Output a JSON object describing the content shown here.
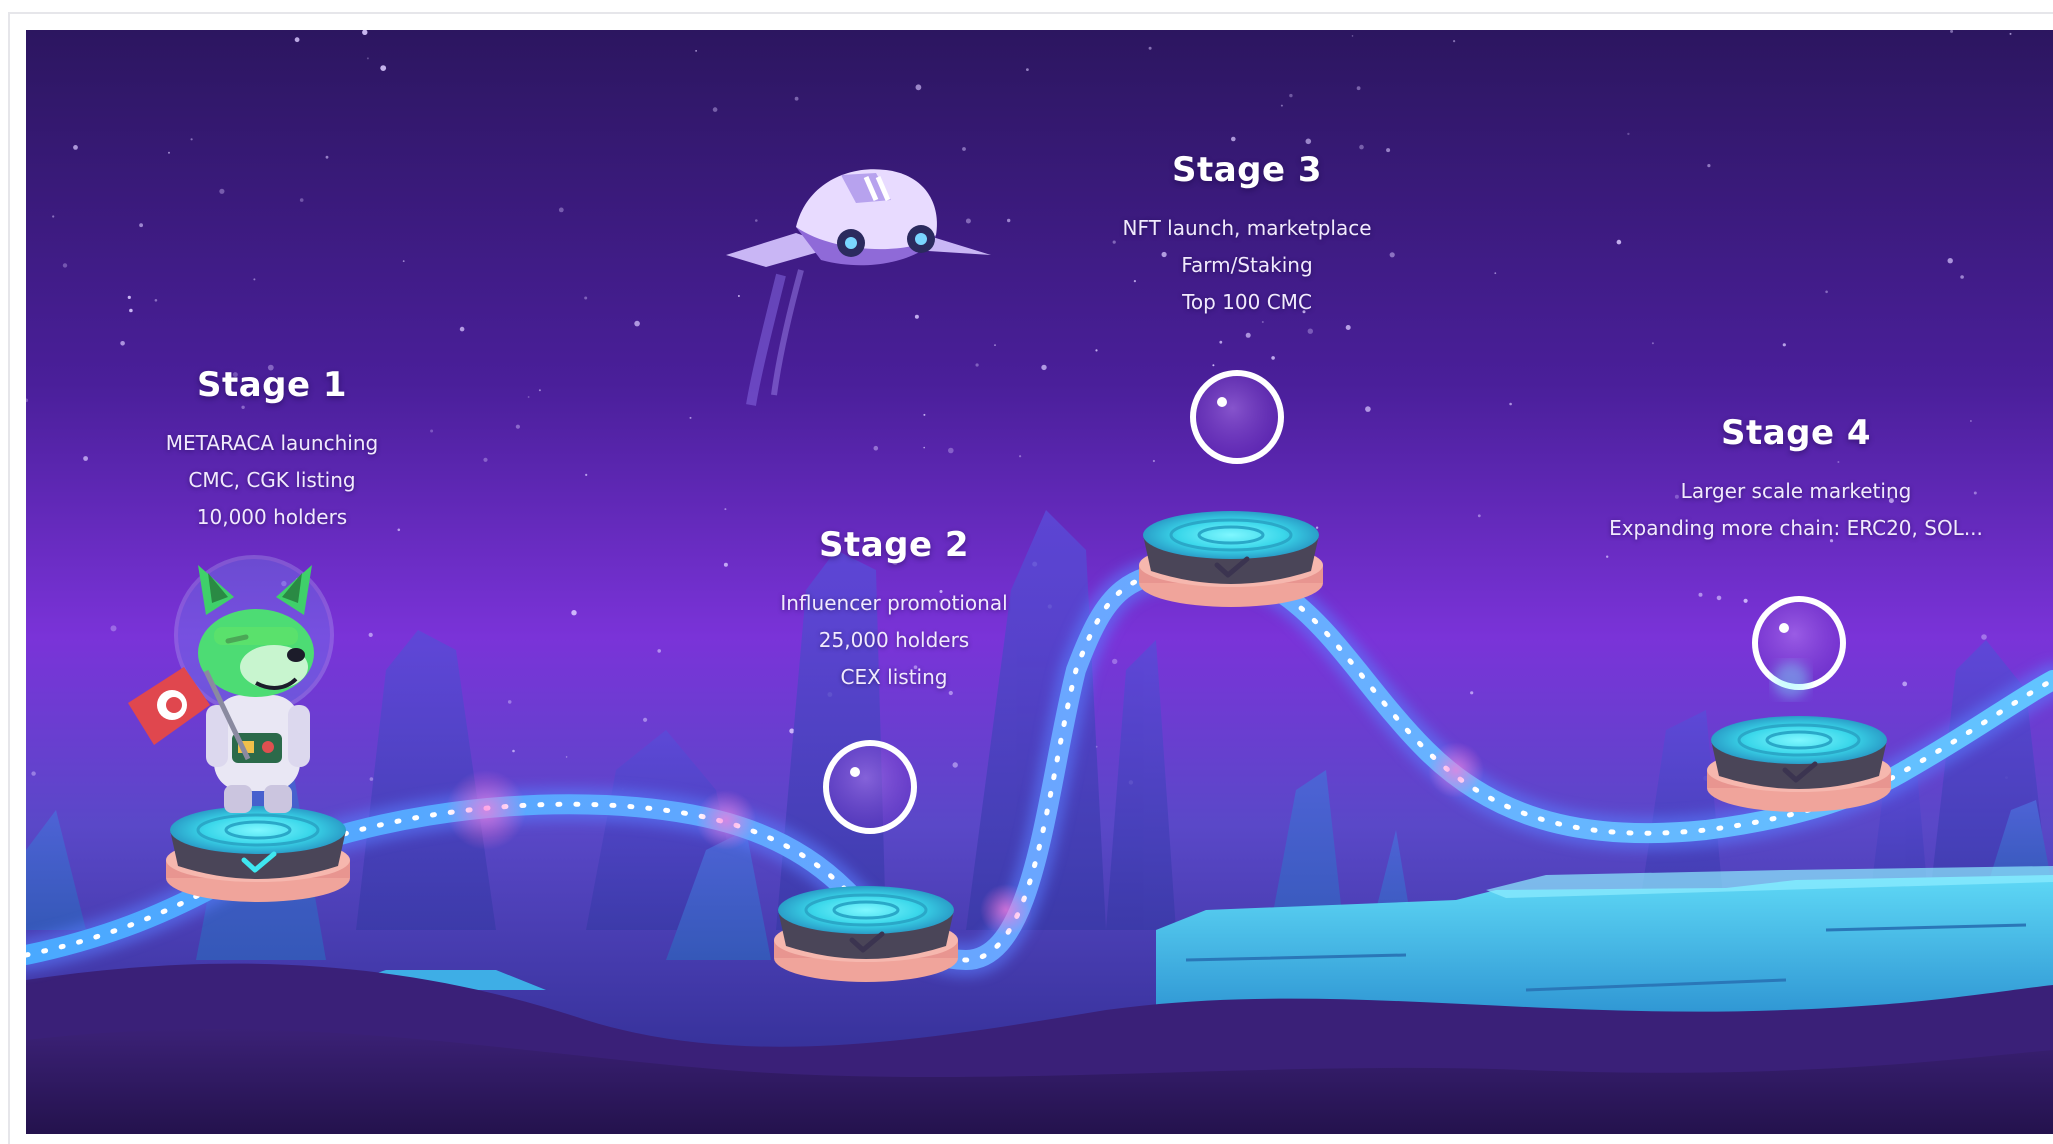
{
  "stages": [
    {
      "title": "Stage 1",
      "lines": [
        "METARACA launching",
        "CMC, CGK listing",
        "10,000 holders"
      ],
      "status": "completed",
      "checkmark": "check-icon"
    },
    {
      "title": "Stage 2",
      "lines": [
        "Influencer promotional",
        "25,000 holders",
        "CEX listing"
      ],
      "status": "pending",
      "checkmark": "check-icon"
    },
    {
      "title": "Stage 3",
      "lines": [
        "NFT launch, marketplace",
        "Farm/Staking",
        "Top 100 CMC"
      ],
      "status": "pending",
      "checkmark": "check-icon"
    },
    {
      "title": "Stage 4",
      "lines": [
        "Larger scale marketing",
        "Expanding more chain: ERC20, SOL..."
      ],
      "status": "pending",
      "checkmark": "check-icon"
    }
  ],
  "characters": {
    "mascot": "astronaut-dog-icon",
    "flag": "flag-icon",
    "ship": "spaceship-icon",
    "bubble": "bubble-icon"
  },
  "colors": {
    "sky_top": "#2c1660",
    "sky_mid": "#6a2bd0",
    "sky_low": "#8b3fe0",
    "ground": "#2a1556",
    "ice": "#38c7ee",
    "platform_glow": "#3fe7f0",
    "platform_rim": "#f0a49b",
    "check_done": "#3fe7f0",
    "check_pending": "#3b3450"
  }
}
